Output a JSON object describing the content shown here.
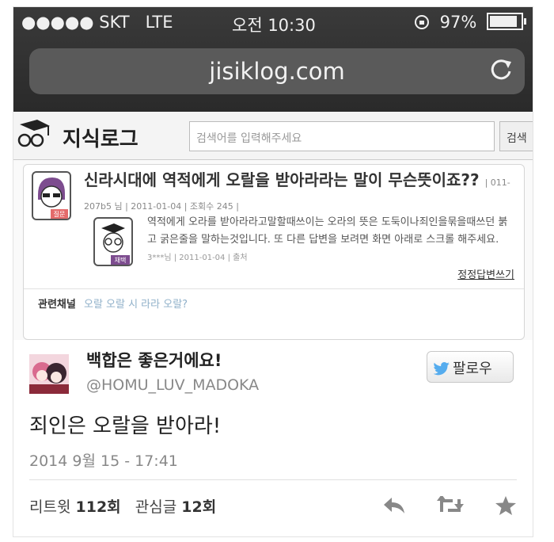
{
  "status_bar": {
    "carrier": "●●●●● SKT",
    "network": "LTE",
    "time": "오전 10:30",
    "battery": "97%"
  },
  "browser": {
    "url": "jisiklog.com"
  },
  "site": {
    "name": "지식로그",
    "search_placeholder": "검색어를 입력해주세요",
    "search_button": "검색"
  },
  "question": {
    "title": "신라시대에 역적에게 오랄을 받아라라는 말이 무슨뜻이죠??",
    "meta": "| 011-207b5 님 | 2011-01-04 | 조회수 245 |",
    "badge": "질문"
  },
  "answer": {
    "text": "역적에게 오라를 받아라라고말할때쓰이는 오라의 뜻은 도둑이나죄인을묶을때쓰던 붉고 굵은줄을 말하는것입니다. 또 다른 답변을 보려면 화면 아래로 스크롤 해주세요.",
    "meta": "3***님 | 2011-01-04 | 출처",
    "badge": "채택",
    "write_link": "정정답변쓰기"
  },
  "related": {
    "label": "관련채널",
    "keywords": "오랄 오랄 시 라라 오랄?"
  },
  "tweet": {
    "name": "백합은 좋은거에요!",
    "handle": "@HOMU_LUV_MADOKA",
    "follow_label": "팔로우",
    "text": "죄인은 오랄을 받아라!",
    "timestamp": "2014 9월 15 - 17:41",
    "retweets_label": "리트윗",
    "retweets_count": "112회",
    "likes_label": "관심글",
    "likes_count": "12회"
  },
  "colors": {
    "top_bar": "#2f2f2f",
    "url_field": "#5a5a5a",
    "twitter_blue": "#55acee",
    "keyword_link": "#8fb0c9"
  }
}
